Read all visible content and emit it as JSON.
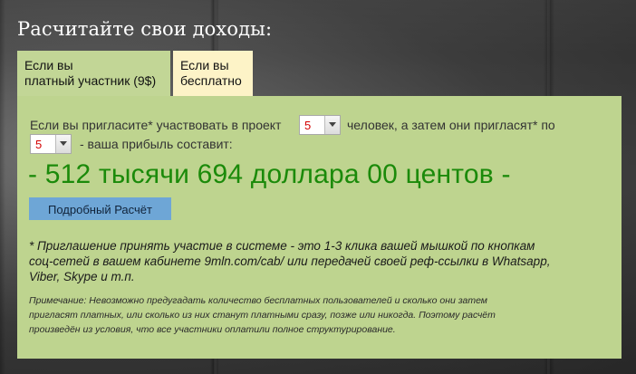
{
  "page": {
    "title": "Расчитайте свои доходы:"
  },
  "tabs": [
    {
      "line1": "Если вы",
      "line2": "платный участник (9$)"
    },
    {
      "line1": "Если вы",
      "line2": "бесплатно"
    }
  ],
  "calculator": {
    "text_before_first": "Если вы пригласите* участвовать в проект",
    "first_select_value": "5",
    "text_after_first": "человек, а затем они пригласят* по",
    "second_select_value": "5",
    "text_after_second": "- ваша прибыль составит:",
    "result": "- 512 тысячи 694 доллара 00 центов -",
    "details_button": "Подробный Расчёт"
  },
  "footnote": [
    "* Приглашение принять участие в системе - это 1-3 клика вашей мышкой по кнопкам",
    "соц-сетей в вашем кабинете 9mln.com/cab/ или передачей своей реф-ссылки в Whatsapp,",
    "Viber, Skype и т.п."
  ],
  "note": [
    "Примечание: Невозможно предугадать количество бесплатных пользователей и сколько они затем",
    "пригласят платных, или сколько из них станут платными сразу, позже или никогда. Поэтому расчёт",
    "произведён из условия, что все участники оплатили полное структурирование."
  ],
  "colors": {
    "panel_bg": "#bed48f",
    "active_tab_bg": "#c2d696",
    "inactive_tab_bg": "#fdf3c7",
    "result_green": "#1b8a0a",
    "button_blue": "#6ea6d6",
    "select_value_red": "#d40000"
  },
  "icons": {
    "select_arrow": "chevron-down-icon"
  }
}
